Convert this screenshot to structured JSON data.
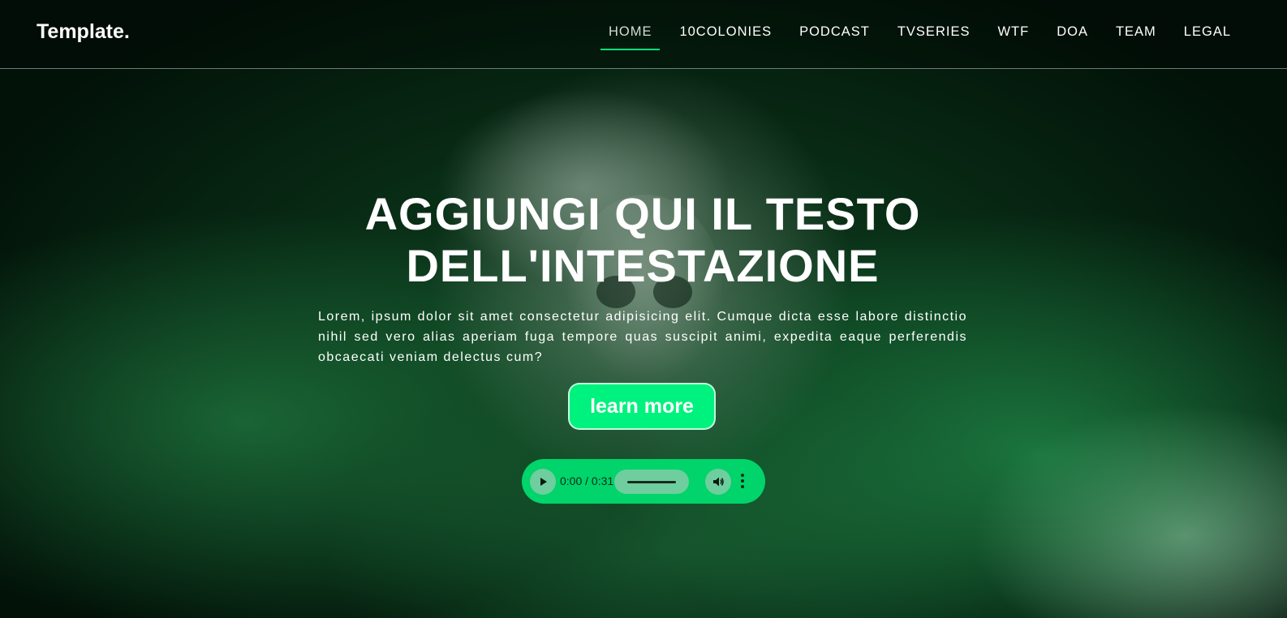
{
  "brand": "Template.",
  "nav": {
    "items": [
      {
        "label": "HOME",
        "active": true
      },
      {
        "label": "10COLONIES",
        "active": false
      },
      {
        "label": "PODCAST",
        "active": false
      },
      {
        "label": "TVSERIES",
        "active": false
      },
      {
        "label": "WTF",
        "active": false
      },
      {
        "label": "DOA",
        "active": false
      },
      {
        "label": "TEAM",
        "active": false
      },
      {
        "label": "LEGAL",
        "active": false
      }
    ]
  },
  "hero": {
    "title": "AGGIUNGI QUI IL TESTO DELL'INTESTAZIONE",
    "text": "Lorem, ipsum dolor sit amet consectetur adipisicing elit. Cumque dicta esse labore distinctio nihil sed vero alias aperiam fuga tempore quas suscipit animi, expedita eaque perferendis obcaecati veniam delectus cum?",
    "cta_label": "learn more"
  },
  "audio": {
    "time": "0:00 / 0:31",
    "play_icon": "play-icon",
    "volume_icon": "volume-icon",
    "more_icon": "more-vertical-icon"
  },
  "colors": {
    "accent": "#00f27e",
    "player_bg": "#00d46a",
    "active_underline": "#00e27a"
  }
}
